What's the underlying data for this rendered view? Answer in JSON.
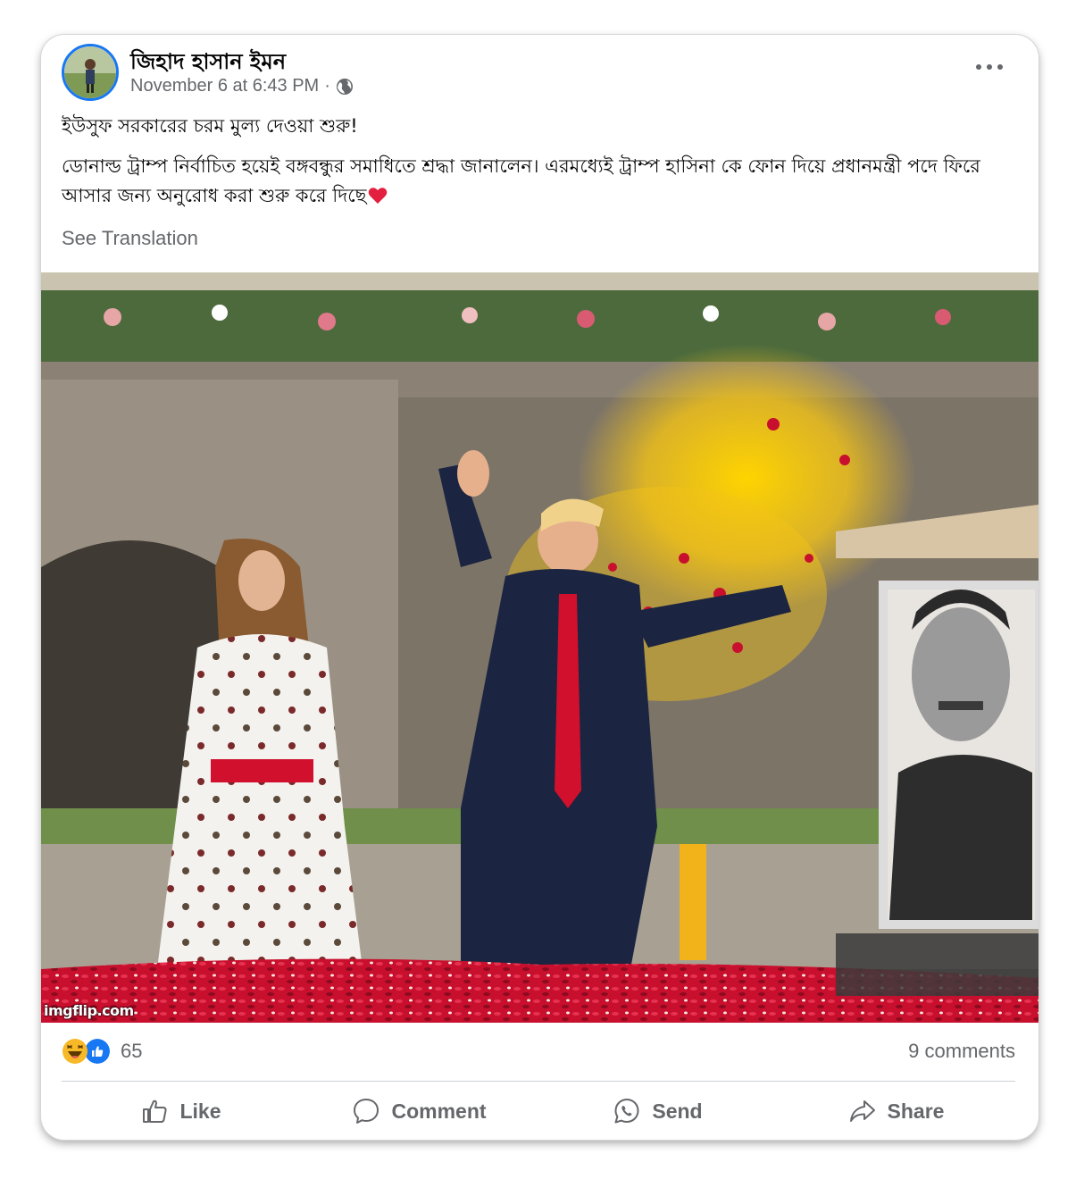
{
  "post": {
    "author": "জিহাদ হাসান ইমন",
    "timestamp": "November 6 at 6:43 PM",
    "meta_separator": "·",
    "audience_icon": "globe-icon",
    "more_icon": "more-options-icon",
    "text_line1": "ইউসুফ সরকারের চরম মুল্য দেওয়া শুরু!",
    "text_line2": "ডোনাল্ড ট্রাম্প নির্বাচিত হয়েই বঙ্গবন্ধুর সমাধিতে শ্রদ্ধা জানালেন। এরমধ্যেই ট্রাম্প হাসিনা কে ফোন দিয়ে প্রধানমন্ত্রী পদে ফিরে আসার জন্য অনুরোধ করা শুরু করে দিছে",
    "emoji": "heart-icon",
    "see_translation": "See Translation",
    "photo_watermark": "imgflip.com"
  },
  "reactions": {
    "icons": [
      "haha-icon",
      "like-icon"
    ],
    "count": "65",
    "comments": "9 comments"
  },
  "actions": {
    "like": "Like",
    "comment": "Comment",
    "send": "Send",
    "share": "Share"
  },
  "colors": {
    "link_blue": "#1877f2",
    "secondary_text": "#65676b",
    "reaction_haha": "#f7b928",
    "heart_red": "#e41e3f"
  }
}
